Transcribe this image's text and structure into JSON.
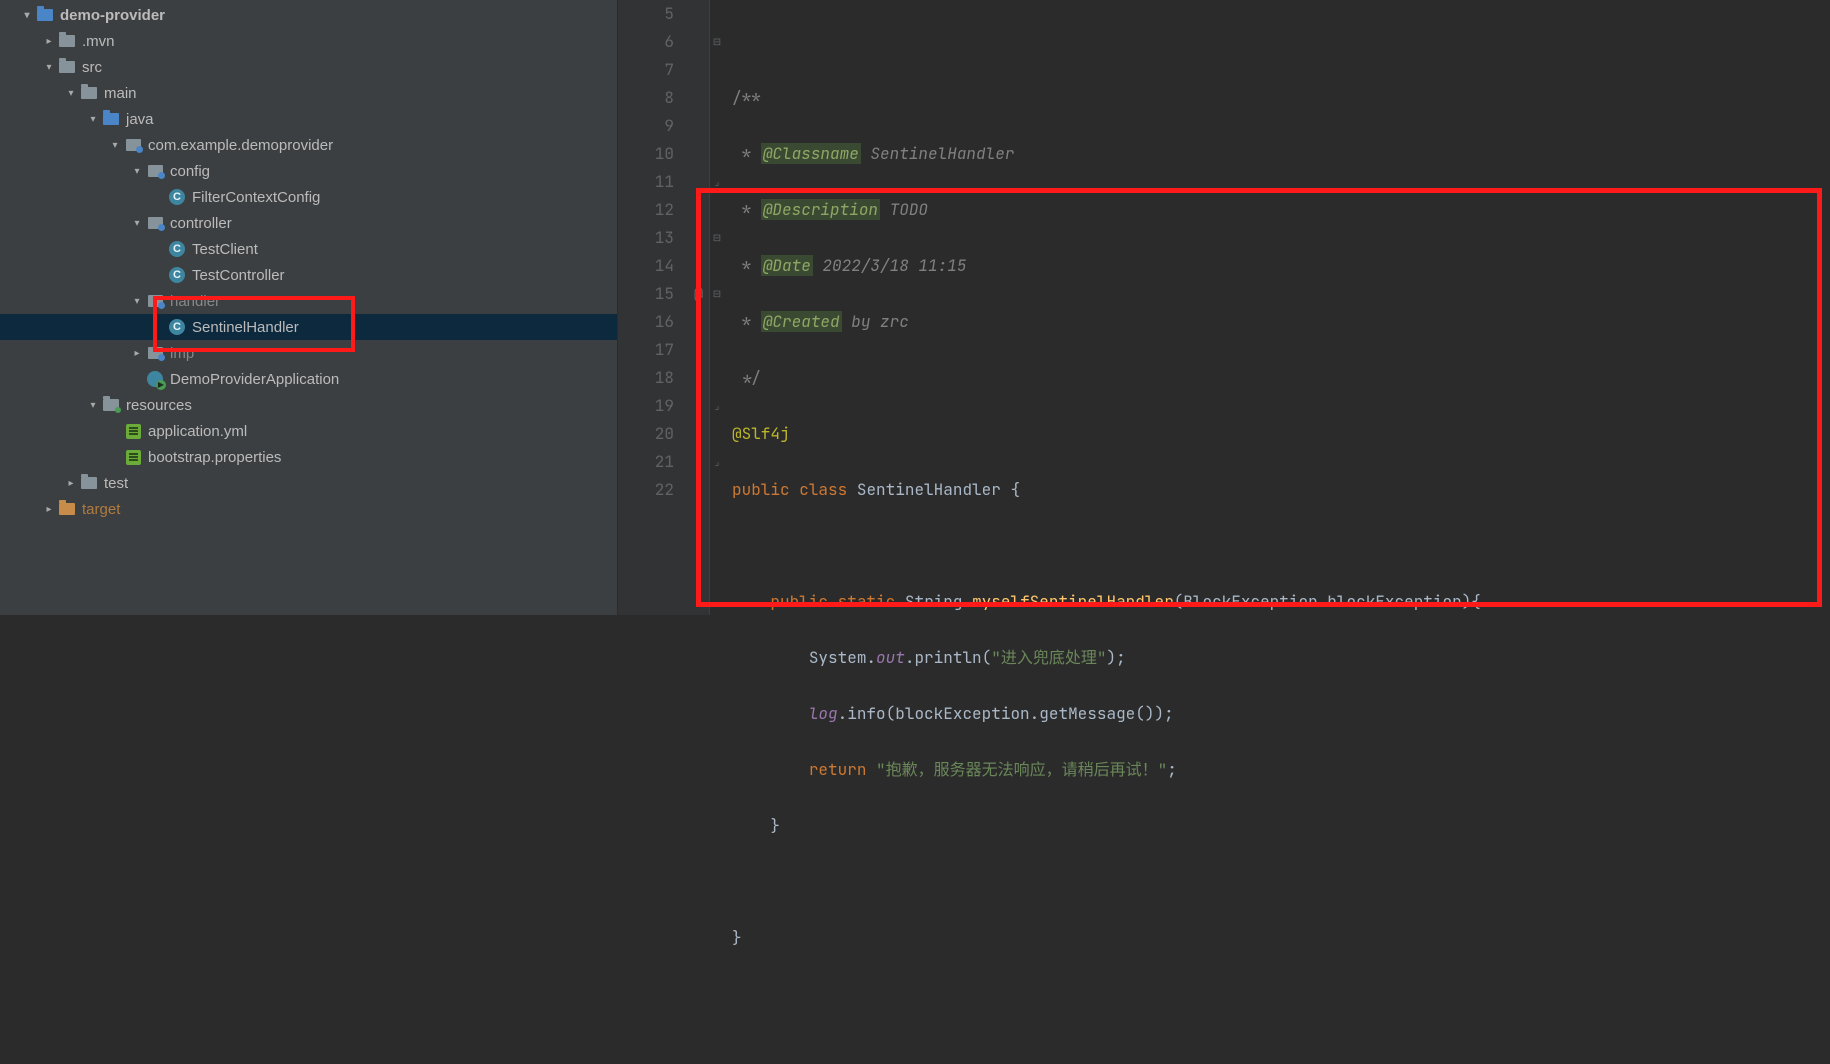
{
  "tree": {
    "n0": "demo-provider",
    "n1": ".mvn",
    "n2": "src",
    "n3": "main",
    "n4": "java",
    "n5": "com.example.demoprovider",
    "n6": "config",
    "n7": "FilterContextConfig",
    "n8": "controller",
    "n9": "TestClient",
    "n10": "TestController",
    "n11": "handler",
    "n12": "SentinelHandler",
    "n13": "imp",
    "n14": "DemoProviderApplication",
    "n15": "resources",
    "n16": "application.yml",
    "n17": "bootstrap.properties",
    "n18": "test",
    "n19": "target"
  },
  "gutter": {
    "l5": "5",
    "l6": "6",
    "l7": "7",
    "l8": "8",
    "l9": "9",
    "l10": "10",
    "l11": "11",
    "l12": "12",
    "l13": "13",
    "l14": "14",
    "l15": "15",
    "l16": "16",
    "l17": "17",
    "l18": "18",
    "l19": "19",
    "l20": "20",
    "l21": "21",
    "l22": "22",
    "mark15": "@"
  },
  "code": {
    "c6_open": "/**",
    "star": " * ",
    "tag_classname": "@Classname",
    "val_classname": " SentinelHandler",
    "tag_desc": "@Description",
    "val_desc": " TODO",
    "tag_date": "@Date",
    "val_date": " 2022/3/18 11:15",
    "tag_created": "@Created",
    "val_created": " by zrc",
    "c11_close": " */",
    "ann_slf4j": "@Slf4j",
    "kw_public": "public",
    "kw_class": "class",
    "cls_name": "SentinelHandler",
    "brace_open": " {",
    "kw_static": "static",
    "ret_type": "String",
    "method": "myselfSentinelHandler",
    "paren_open": "(",
    "param_type": "BlockException",
    "param_name": " blockException",
    "paren_close_brace": "){",
    "sys": "System",
    "dot": ".",
    "out": "out",
    "println": "println",
    "str1": "\"进入兜底处理\"",
    "semi": ";",
    "log": "log",
    "info": "info",
    "be": "blockException",
    "getmsg": "getMessage",
    "empty_paren": "()",
    "close_paren_semi": ");",
    "kw_return": "return",
    "str2": "\"抱歉，服务器无法响应，请稍后再试！\"",
    "brace_close": "}",
    "space4": "    ",
    "space8": "        "
  }
}
